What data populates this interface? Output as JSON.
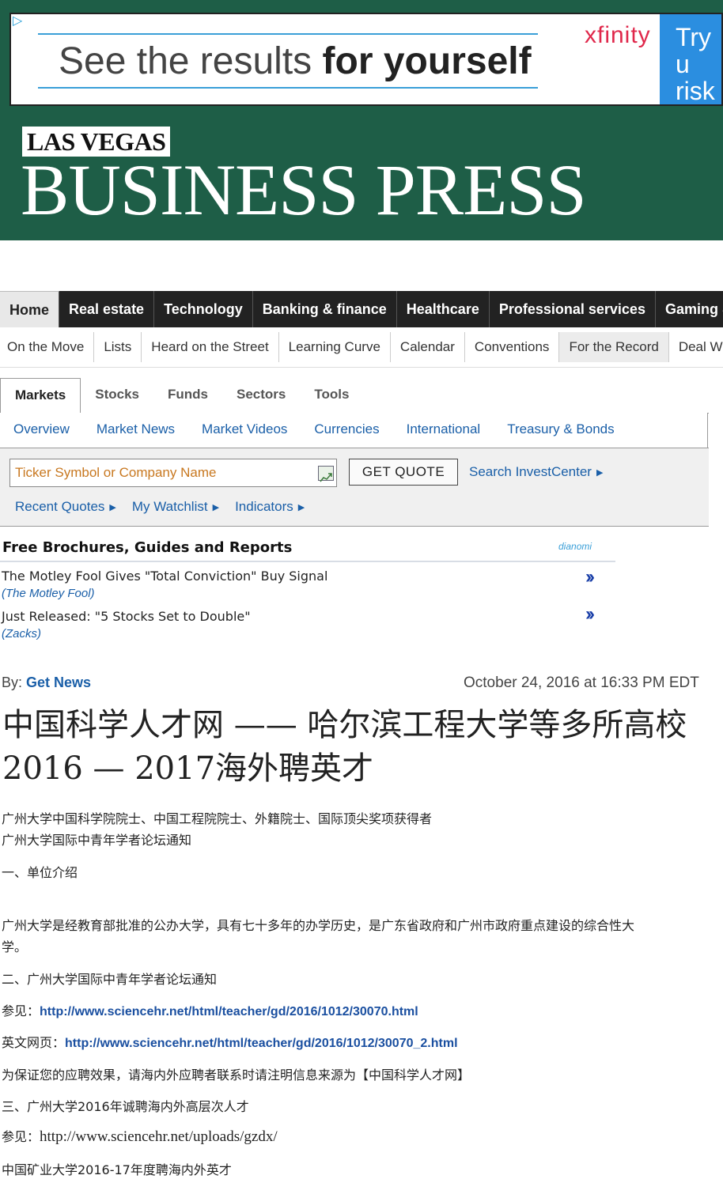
{
  "ad": {
    "headline_light": "See the results",
    "headline_bold": "for yourself",
    "brand": "xfinity",
    "cta_line1": "Try u",
    "cta_line2": "risk f"
  },
  "masthead": {
    "small": "LAS VEGAS",
    "big": "BUSINESS PRESS"
  },
  "nav_primary": [
    "Home",
    "Real estate",
    "Technology",
    "Banking & finance",
    "Healthcare",
    "Professional services",
    "Gaming &"
  ],
  "nav_secondary": [
    "On the Move",
    "Lists",
    "Heard on the Street",
    "Learning Curve",
    "Calendar",
    "Conventions",
    "For the Record",
    "Deal W"
  ],
  "markets": {
    "tabs": [
      "Markets",
      "Stocks",
      "Funds",
      "Sectors",
      "Tools"
    ],
    "sub_links": [
      "Overview",
      "Market News",
      "Market Videos",
      "Currencies",
      "International",
      "Treasury & Bonds"
    ],
    "ticker_placeholder": "Ticker Symbol or Company Name",
    "quote_button": "GET QUOTE",
    "search_link": "Search InvestCenter",
    "row2_links": [
      "Recent Quotes",
      "My Watchlist",
      "Indicators"
    ]
  },
  "brochures": {
    "title": "Free Brochures, Guides and Reports",
    "brand": "dianomi",
    "items": [
      {
        "title": "The Motley Fool Gives \"Total Conviction\" Buy Signal",
        "source": "(The Motley Fool)"
      },
      {
        "title": "Just Released: \"5 Stocks Set to Double\"",
        "source": "(Zacks)"
      }
    ]
  },
  "article": {
    "by_label": "By:",
    "author": "Get News",
    "date": "October 24, 2016 at 16:33 PM EDT",
    "headline_line1": "中国科学人才网 —— 哈尔滨工程大学等多所高校",
    "headline_line2": "2016 — 2017海外聘英才",
    "lines": {
      "l1": "广州大学中国科学院院士、中国工程院院士、外籍院士、国际顶尖奖项获得者",
      "l2": "广州大学国际中青年学者论坛通知",
      "l3": "一、单位介绍",
      "l4": "广州大学是经教育部批准的公办大学，具有七十多年的办学历史，是广东省政府和广州市政府重点建设的综合性大",
      "l5": "学。",
      "l6": "二、广州大学国际中青年学者论坛通知",
      "l7_label": "参见：",
      "l7_link": "http://www.sciencehr.net/html/teacher/gd/2016/1012/30070.html",
      "l8_label": "英文网页：",
      "l8_link": "http://www.sciencehr.net/html/teacher/gd/2016/1012/30070_2.html",
      "l9": "为保证您的应聘效果，请海内外应聘者联系时请注明信息来源为【中国科学人才网】",
      "l10": "三、广州大学2016年诚聘海内外高层次人才",
      "l11_label": "参见：",
      "l11_link": "http://www.sciencehr.net/uploads/gzdx/",
      "l12": "中国矿业大学2016-17年度聘海内外英才"
    }
  },
  "colors": {
    "brand_green": "#1e5e47",
    "link_blue": "#1a5fa8",
    "nav_dark": "#222222",
    "xfinity_red": "#e0284b"
  }
}
